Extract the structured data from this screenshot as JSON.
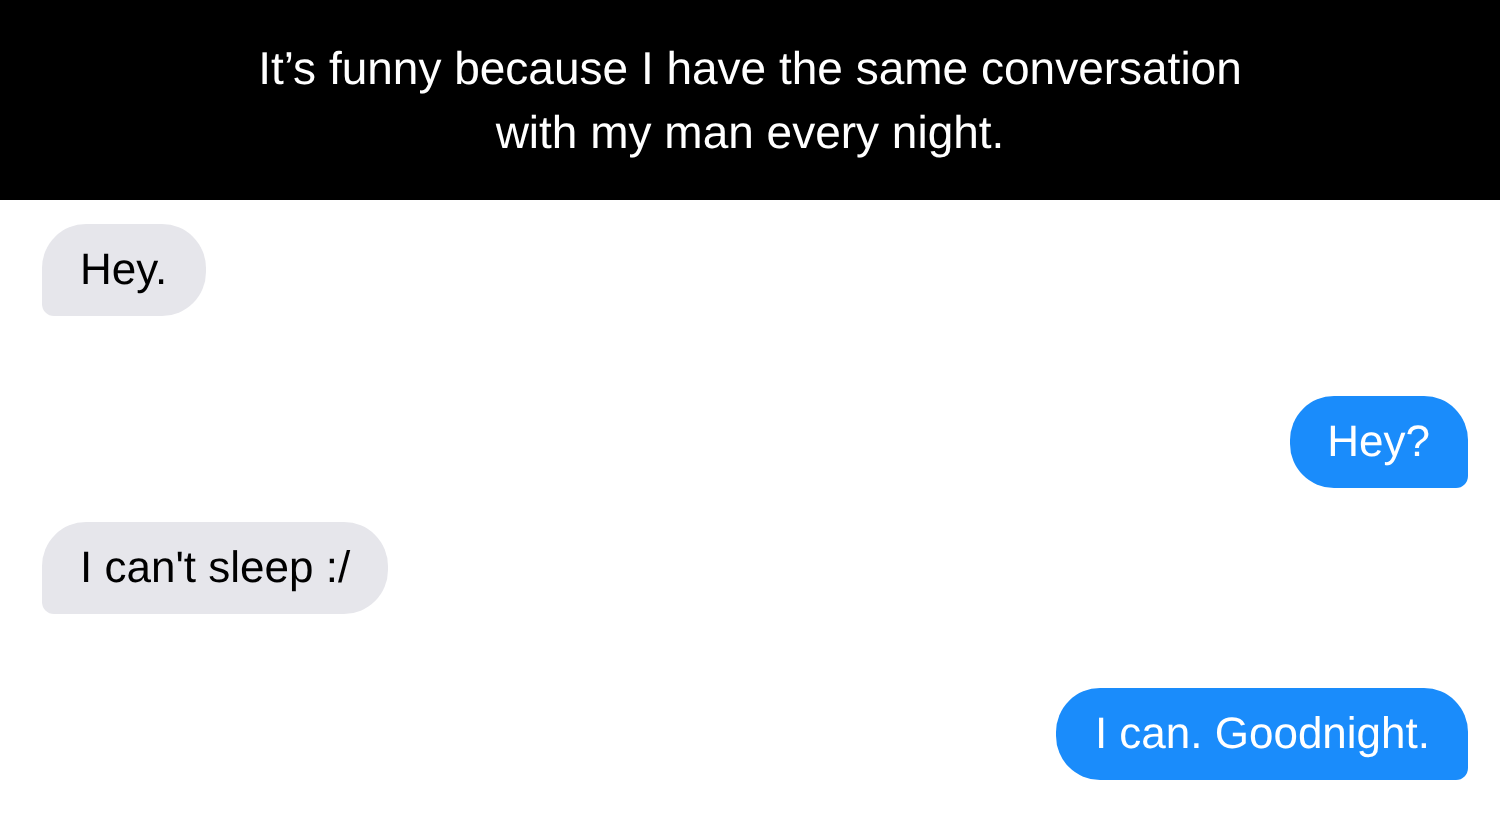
{
  "caption": "It’s funny because I have the same conversation with my man every night.",
  "messages": [
    {
      "kind": "received",
      "text": "Hey."
    },
    {
      "kind": "sent",
      "text": "Hey?"
    },
    {
      "kind": "received",
      "text": "I can't sleep :/"
    },
    {
      "kind": "sent",
      "text": "I can. Goodnight."
    }
  ]
}
